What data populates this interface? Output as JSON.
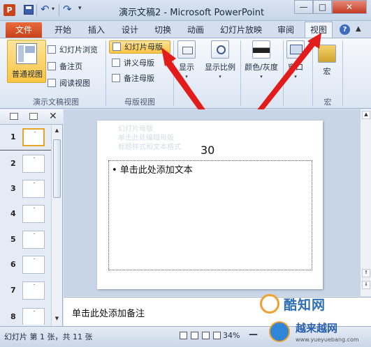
{
  "window": {
    "app_icon": "P",
    "title": "演示文稿2  -  Microsoft PowerPoint",
    "min_label": "—",
    "max_label": "□",
    "close_label": "✕"
  },
  "qat": {
    "undo": "↶",
    "redo": "↷",
    "dropdown": "▾",
    "more": "▾"
  },
  "tabs": {
    "file": "文件",
    "items": [
      "开始",
      "插入",
      "设计",
      "切换",
      "动画",
      "幻灯片放映",
      "审阅"
    ],
    "active": "视图",
    "help": "?",
    "minimize": "▲"
  },
  "ribbon": {
    "presentation_views": {
      "label": "演示文稿视图",
      "normal": "普通视图",
      "slide_sorter": "幻灯片浏览",
      "notes_page": "备注页",
      "reading_view": "阅读视图"
    },
    "master_views": {
      "label": "母版视图",
      "slide_master": "幻灯片母版",
      "handout_master": "讲义母版",
      "notes_master": "备注母版"
    },
    "show": "显示",
    "zoom": "显示比例",
    "color": "颜色/灰度",
    "window": "窗口",
    "macros": {
      "button": "宏",
      "label": "宏"
    }
  },
  "slides_pane": {
    "close": "✕",
    "numbers": [
      "1",
      "2",
      "3",
      "4",
      "5",
      "6",
      "7",
      "8"
    ],
    "selected": "1",
    "scroll_up": "▲",
    "scroll_down": "▼"
  },
  "slide": {
    "title": "30",
    "ghost_lines": [
      "幻灯片母版",
      "单击此处编辑母版",
      "标题样式和文本格式"
    ],
    "body": "• 单击此处添加文本"
  },
  "right_scroll": {
    "up": "▲",
    "prev": "⇑",
    "next": "⇓"
  },
  "notes": {
    "placeholder": "单击此处添加备注"
  },
  "status": {
    "slide_info": "幻灯片 第 1 张，共 11 张",
    "zoom": "34%",
    "zoom_minus": "—"
  },
  "watermark": {
    "site1": "酷知网",
    "site2": "越来越网",
    "url": "www.yueyuebang.com"
  },
  "colors": {
    "accent": "#fbc443",
    "file_tab": "#c8421a",
    "arrow": "#e21b1b"
  }
}
